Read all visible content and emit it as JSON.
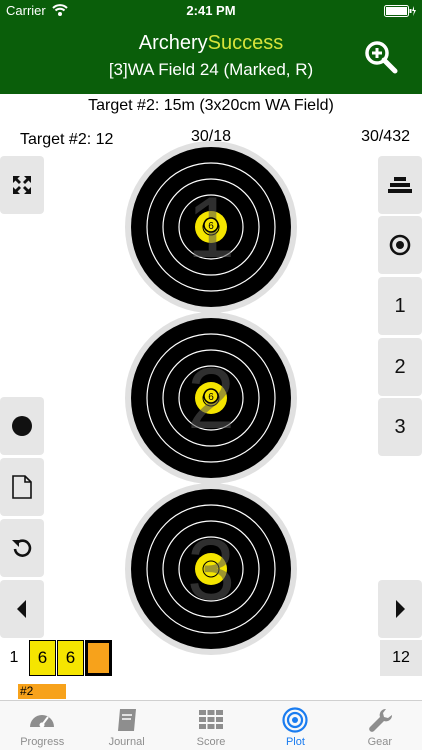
{
  "status": {
    "carrier": "Carrier",
    "time": "2:41 PM"
  },
  "header": {
    "title_part1": "Archery",
    "title_part2": "Success",
    "subtitle": "[3]WA Field 24 (Marked, R)"
  },
  "target_heading": "Target #2: 15m (3x20cm WA Field)",
  "labels": {
    "left": "Target #2: 12",
    "center": "30/18",
    "right": "30/432"
  },
  "right_buttons": {
    "b1": "1",
    "b2": "2",
    "b3": "3"
  },
  "faces": [
    {
      "number": "1",
      "arrow_value": "6"
    },
    {
      "number": "2",
      "arrow_value": "6"
    },
    {
      "number": "3",
      "arrow_value": ""
    }
  ],
  "score_row": {
    "end_number": "1",
    "scores": [
      "6",
      "6",
      ""
    ],
    "end_total": "12"
  },
  "end_tag": "#2",
  "tabs": [
    {
      "label": "Progress",
      "icon": "speedometer-icon"
    },
    {
      "label": "Journal",
      "icon": "journal-icon"
    },
    {
      "label": "Score",
      "icon": "grid-icon"
    },
    {
      "label": "Plot",
      "icon": "target-icon"
    },
    {
      "label": "Gear",
      "icon": "wrench-icon"
    }
  ],
  "colors": {
    "header_bg": "#0a5e0a",
    "accent": "#d7e33a",
    "score_yellow": "#f5e500",
    "current_orange": "#f7a21b",
    "tab_active": "#1a7cf0"
  }
}
